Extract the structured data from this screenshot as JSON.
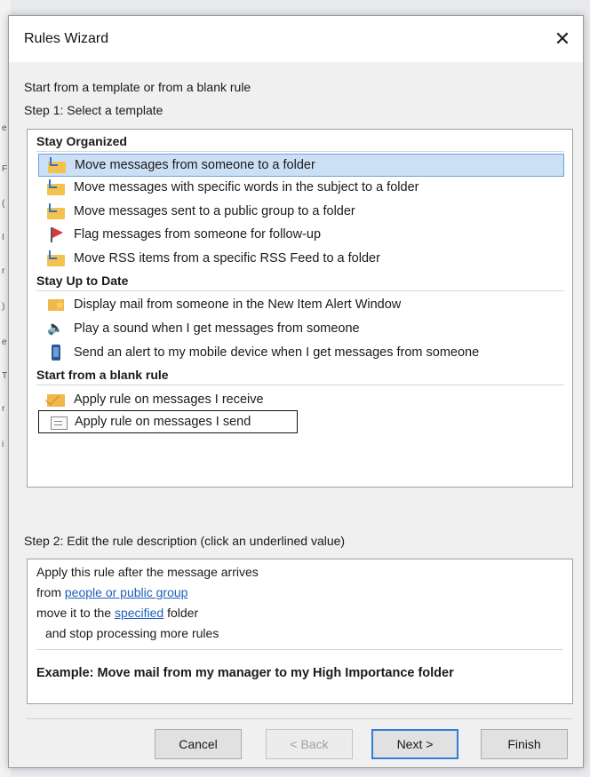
{
  "window": {
    "title": "Rules Wizard",
    "close_glyph": "✕"
  },
  "intro": "Start from a template or from a blank rule",
  "step1": "Step 1: Select a template",
  "templates": {
    "sections": [
      {
        "label": "Stay Organized"
      },
      {
        "label": "Stay Up to Date"
      },
      {
        "label": "Start from a blank rule"
      }
    ],
    "items": [
      {
        "label": "Move messages from someone to a folder",
        "icon": "folder-arrow-icon",
        "selected": true
      },
      {
        "label": "Move messages with specific words in the subject to a folder",
        "icon": "folder-arrow-icon"
      },
      {
        "label": "Move messages sent to a public group to a folder",
        "icon": "folder-arrow-icon"
      },
      {
        "label": "Flag messages from someone for follow-up",
        "icon": "red-flag-icon"
      },
      {
        "label": "Move RSS items from a specific RSS Feed to a folder",
        "icon": "folder-arrow-icon"
      },
      {
        "label": "Display mail from someone in the New Item Alert Window",
        "icon": "envelope-star-icon"
      },
      {
        "label": "Play a sound when I get messages from someone",
        "icon": "speaker-icon"
      },
      {
        "label": "Send an alert to my mobile device when I get messages from someone",
        "icon": "mobile-device-icon"
      },
      {
        "label": "Apply rule on messages I receive",
        "icon": "envelope-icon"
      },
      {
        "label": "Apply rule on messages I send",
        "icon": "send-envelope-icon",
        "outlined": true
      }
    ]
  },
  "step2": "Step 2: Edit the rule description (click an underlined value)",
  "description": {
    "line1": "Apply this rule after the message arrives",
    "line2_prefix": "from ",
    "line2_link": "people or public group",
    "line3_prefix": "move it to the ",
    "line3_link": "specified",
    "line3_suffix": " folder",
    "line4": "and stop processing more rules",
    "example": "Example: Move mail from my manager to my High Importance folder"
  },
  "buttons": {
    "cancel": "Cancel",
    "back": "< Back",
    "next": "Next >",
    "finish": "Finish"
  },
  "colors": {
    "selection": "#cce0f5",
    "link": "#1f5fb8",
    "default_button_border": "#2f7fd6"
  }
}
